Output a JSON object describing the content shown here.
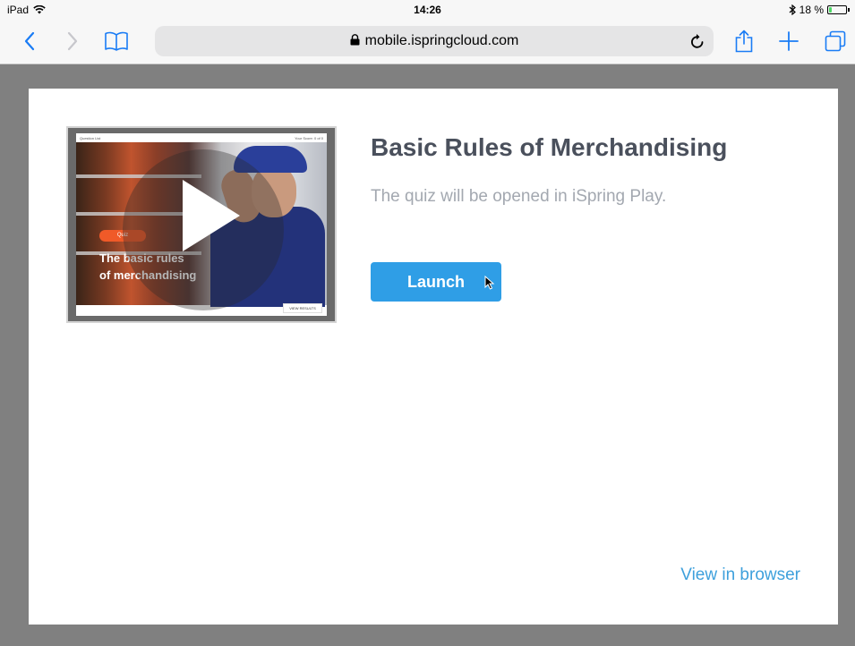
{
  "status_bar": {
    "device": "iPad",
    "time": "14:26",
    "battery": "18 %",
    "battery_level": 0.18
  },
  "toolbar": {
    "url": "mobile.ispringcloud.com",
    "icons": [
      "back-icon",
      "forward-icon",
      "bookmarks-icon",
      "lock-icon",
      "reload-icon",
      "share-icon",
      "new-tab-icon",
      "tabs-icon"
    ]
  },
  "page": {
    "title": "Basic Rules of Merchandising",
    "subtitle": "The quiz will be opened in iSpring Play.",
    "launch_label": "Launch",
    "view_browser_label": "View in browser"
  },
  "thumbnail": {
    "top_left": "Question List",
    "top_right": "Your Score: 0 of 0",
    "badge": "Quiz",
    "title_line1": "The basic rules",
    "title_line2": "of merchandising",
    "view_results": "VIEW RESULTS"
  },
  "colors": {
    "accent": "#2f9ee6",
    "link": "#3ea0dc",
    "title": "#4a505c",
    "badge": "#f05a28"
  }
}
